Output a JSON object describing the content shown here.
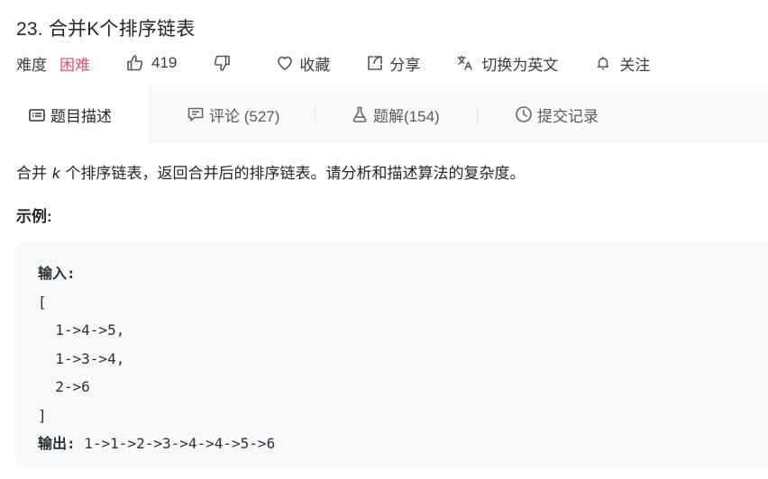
{
  "problem": {
    "title": "23. 合并K个排序链表"
  },
  "meta": {
    "difficulty_label": "难度",
    "difficulty_value": "困难",
    "likes": "419",
    "favorite_label": "收藏",
    "share_label": "分享",
    "translate_label": "切换为英文",
    "follow_label": "关注"
  },
  "tabs": [
    {
      "label": "题目描述"
    },
    {
      "label": "评论 (527)"
    },
    {
      "label": "题解(154)"
    },
    {
      "label": "提交记录"
    }
  ],
  "description": {
    "part1": "合并",
    "k": "k",
    "part2": "个排序链表，返回合并后的排序链表。请分析和描述算法的复杂度。"
  },
  "example": {
    "label": "示例:",
    "input_label": "输入:",
    "lines": [
      "[",
      "  1->4->5,",
      "  1->3->4,",
      "  2->6",
      "]"
    ],
    "output_label": "输出:",
    "output_value": " 1->1->2->3->4->4->5->6"
  },
  "colors": {
    "difficulty_hard": "#ec4c7a",
    "code_bg": "#f7f8fa",
    "tab_bar_bg": "#fafafa"
  }
}
